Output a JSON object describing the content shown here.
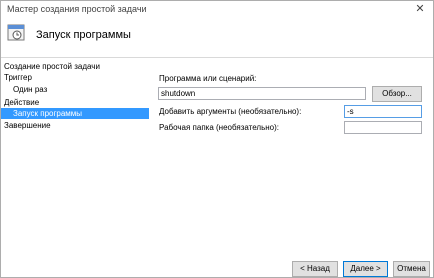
{
  "window": {
    "title": "Мастер создания простой задачи",
    "close_glyph": "✕"
  },
  "header": {
    "title": "Запуск программы",
    "icon": "scheduler-task-icon"
  },
  "steps": [
    {
      "label": "Создание простой задачи",
      "level": "top",
      "active": false
    },
    {
      "label": "Триггер",
      "level": "top",
      "active": false
    },
    {
      "label": "Один раз",
      "level": "sub",
      "active": false
    },
    {
      "label": "Действие",
      "level": "top",
      "active": false
    },
    {
      "label": "Запуск программы",
      "level": "sub",
      "active": true
    },
    {
      "label": "Завершение",
      "level": "top",
      "active": false
    }
  ],
  "form": {
    "program_label": "Программа или сценарий:",
    "program_value": "shutdown",
    "browse_button": "Обзор...",
    "args_label": "Добавить аргументы (необязательно):",
    "args_value": "-s",
    "workdir_label": "Рабочая папка (необязательно):",
    "workdir_value": ""
  },
  "buttons": {
    "back": "< Назад",
    "next": "Далее >",
    "cancel": "Отмена"
  },
  "colors": {
    "selection": "#3399ff",
    "focus_border": "#569de5",
    "primary_border": "#0078d7"
  }
}
